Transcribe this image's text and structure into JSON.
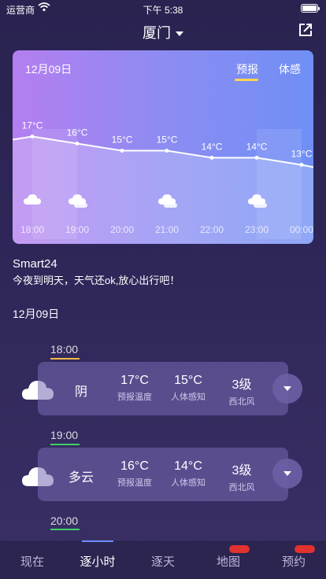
{
  "status_bar": {
    "carrier": "运营商",
    "time": "下午 5:38"
  },
  "nav": {
    "city": "厦门"
  },
  "hero": {
    "date": "12月09日",
    "tab_forecast": "预报",
    "tab_feel": "体感",
    "hours": [
      {
        "label": "18:00",
        "temp": "17°C",
        "icon": "cloud-icon"
      },
      {
        "label": "19:00",
        "temp": "16°C",
        "icon": "partly-cloudy-icon"
      },
      {
        "label": "20:00",
        "temp": "15°C",
        "icon": ""
      },
      {
        "label": "21:00",
        "temp": "15°C",
        "icon": "partly-cloudy-icon"
      },
      {
        "label": "22:00",
        "temp": "14°C",
        "icon": ""
      },
      {
        "label": "23:00",
        "temp": "14°C",
        "icon": "partly-cloudy-icon"
      },
      {
        "label": "00:00",
        "temp": "13°C",
        "icon": ""
      }
    ]
  },
  "smart": {
    "name": "Smart24",
    "message": "今夜到明天，天气还ok,放心出行吧！"
  },
  "section_date": "12月09日",
  "hourly": [
    {
      "time": "18:00",
      "underline_color": "#f2b84b",
      "icon": "cloud-icon",
      "condition": "阴",
      "forecast_temp": "17°C",
      "forecast_label": "预报温度",
      "feel_temp": "15°C",
      "feel_label": "人体感知",
      "wind_level": "3级",
      "wind_dir": "西北风"
    },
    {
      "time": "19:00",
      "underline_color": "#3fcf6a",
      "icon": "cloud-icon",
      "condition": "多云",
      "forecast_temp": "16°C",
      "forecast_label": "预报温度",
      "feel_temp": "14°C",
      "feel_label": "人体感知",
      "wind_level": "3级",
      "wind_dir": "西北风"
    },
    {
      "time": "20:00",
      "underline_color": "#3fcf6a"
    }
  ],
  "tabs": [
    {
      "label": "现在"
    },
    {
      "label": "逐小时"
    },
    {
      "label": "逐天"
    },
    {
      "label": "地图"
    },
    {
      "label": "预约"
    }
  ]
}
